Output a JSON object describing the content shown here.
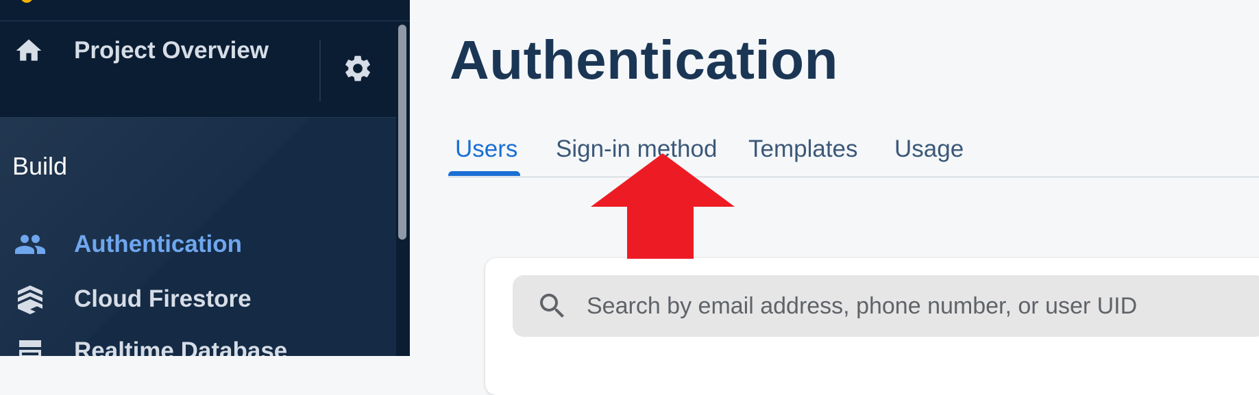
{
  "sidebar": {
    "overview_label": "Project Overview",
    "section_label": "Build",
    "items": [
      {
        "label": "Authentication",
        "icon": "people-icon",
        "active": true
      },
      {
        "label": "Cloud Firestore",
        "icon": "firestore-layers-icon",
        "active": false
      },
      {
        "label": "Realtime Database",
        "icon": "database-icon",
        "active": false
      }
    ]
  },
  "main": {
    "title": "Authentication",
    "tabs": [
      {
        "label": "Users",
        "active": true
      },
      {
        "label": "Sign-in method",
        "active": false
      },
      {
        "label": "Templates",
        "active": false
      },
      {
        "label": "Usage",
        "active": false
      }
    ],
    "search": {
      "placeholder": "Search by email address, phone number, or user UID",
      "value": ""
    }
  },
  "colors": {
    "sidebar_bg": "#142a45",
    "sidebar_active": "#6fa6ee",
    "tab_active": "#1a6fd4",
    "title": "#1b3655",
    "annotation_arrow": "#ed1c24"
  }
}
